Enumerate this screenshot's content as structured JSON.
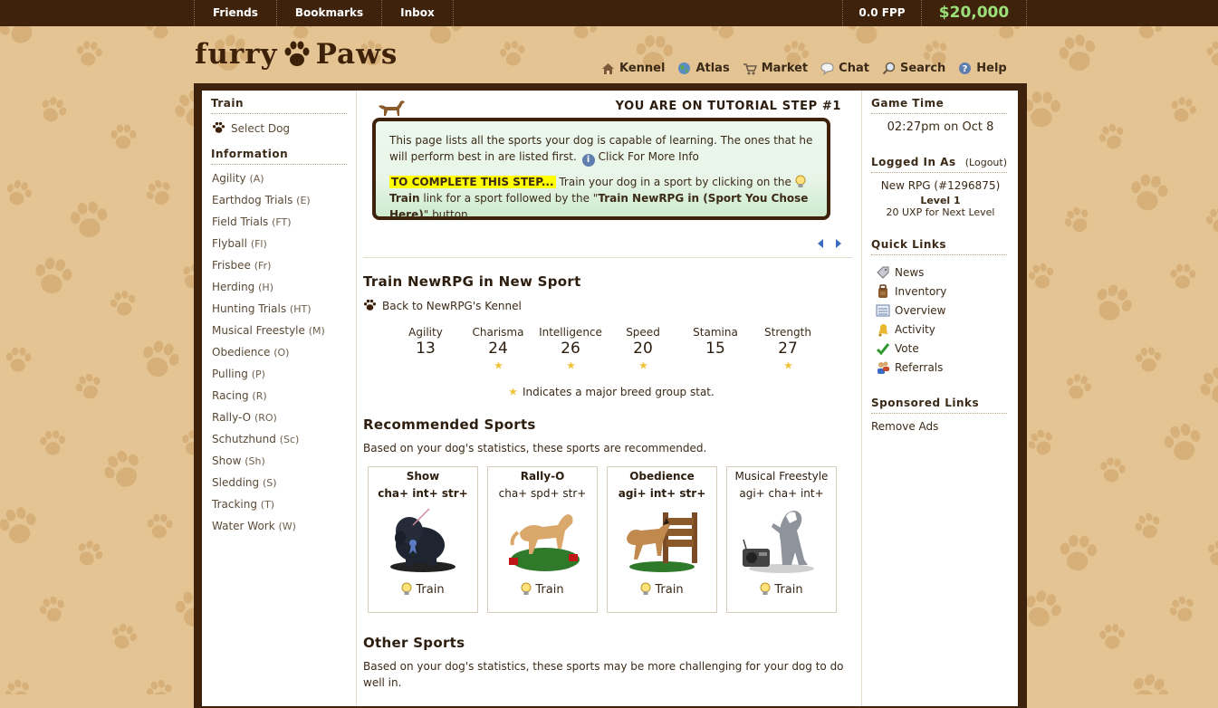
{
  "topbar": {
    "links": [
      "Friends",
      "Bookmarks",
      "Inbox"
    ],
    "fpp": "0.0 FPP",
    "money": "$20,000"
  },
  "logo": {
    "left": "furry",
    "right": "Paws"
  },
  "mainnav": [
    "Kennel",
    "Atlas",
    "Market",
    "Chat",
    "Search",
    "Help"
  ],
  "left": {
    "train_heading": "Train",
    "select_dog": "Select Dog",
    "info_heading": "Information",
    "sports": [
      {
        "name": "Agility",
        "abbr": "(A)"
      },
      {
        "name": "Earthdog Trials",
        "abbr": "(E)"
      },
      {
        "name": "Field Trials",
        "abbr": "(FT)"
      },
      {
        "name": "Flyball",
        "abbr": "(Fl)"
      },
      {
        "name": "Frisbee",
        "abbr": "(Fr)"
      },
      {
        "name": "Herding",
        "abbr": "(H)"
      },
      {
        "name": "Hunting Trials",
        "abbr": "(HT)"
      },
      {
        "name": "Musical Freestyle",
        "abbr": "(M)"
      },
      {
        "name": "Obedience",
        "abbr": "(O)"
      },
      {
        "name": "Pulling",
        "abbr": "(P)"
      },
      {
        "name": "Racing",
        "abbr": "(R)"
      },
      {
        "name": "Rally-O",
        "abbr": "(RO)"
      },
      {
        "name": "Schutzhund",
        "abbr": "(Sc)"
      },
      {
        "name": "Show",
        "abbr": "(Sh)"
      },
      {
        "name": "Sledding",
        "abbr": "(S)"
      },
      {
        "name": "Tracking",
        "abbr": "(T)"
      },
      {
        "name": "Water Work",
        "abbr": "(W)"
      }
    ]
  },
  "tutorial": {
    "title": "YOU ARE ON TUTORIAL STEP #1",
    "p1": "This page lists all the sports your dog is capable of learning. The ones that he will perform best in are listed first.",
    "more_info": "Click For More Info",
    "highlight": "TO COMPLETE THIS STEP...",
    "p2a": "Train your dog in a sport by clicking on the",
    "train_word": "Train",
    "p2b": "link for a sport followed by the \"",
    "button_name": "Train NewRPG in (Sport You Chose Here)",
    "p2c": "\" button."
  },
  "train": {
    "heading": "Train NewRPG in New Sport",
    "back": "Back to NewRPG's Kennel",
    "stats": [
      {
        "label": "Agility",
        "value": "13",
        "major": false
      },
      {
        "label": "Charisma",
        "value": "24",
        "major": true
      },
      {
        "label": "Intelligence",
        "value": "26",
        "major": true
      },
      {
        "label": "Speed",
        "value": "20",
        "major": true
      },
      {
        "label": "Stamina",
        "value": "15",
        "major": false
      },
      {
        "label": "Strength",
        "value": "27",
        "major": true
      }
    ],
    "star_note": "Indicates a major breed group stat."
  },
  "recommended": {
    "heading": "Recommended Sports",
    "desc": "Based on your dog's statistics, these sports are recommended.",
    "cards": [
      {
        "name": "Show",
        "stats": "cha+ int+ str+",
        "train": "Train"
      },
      {
        "name": "Rally-O",
        "stats": "cha+ spd+ str+",
        "train": "Train"
      },
      {
        "name": "Obedience",
        "stats": "agi+ int+ str+",
        "train": "Train"
      },
      {
        "name": "Musical Freestyle",
        "stats": "agi+ cha+ int+",
        "train": "Train"
      }
    ]
  },
  "other": {
    "heading": "Other Sports",
    "desc": "Based on your dog's statistics, these sports may be more challenging for your dog to do well in."
  },
  "right": {
    "game_time_heading": "Game Time",
    "game_time": "02:27pm on Oct 8",
    "logged_heading": "Logged In As",
    "logout": "(Logout)",
    "user": "New RPG (#1296875)",
    "level": "Level 1",
    "uxp": "20 UXP for Next Level",
    "quick_heading": "Quick Links",
    "quick_links": [
      "News",
      "Inventory",
      "Overview",
      "Activity",
      "Vote",
      "Referrals"
    ],
    "sponsored_heading": "Sponsored Links",
    "remove_ads": "Remove Ads"
  },
  "colors": {
    "background": "#e3c492",
    "frame": "#3e220b",
    "money": "#9be07a",
    "highlight": "#ffff00",
    "paw": "#d6b078"
  }
}
